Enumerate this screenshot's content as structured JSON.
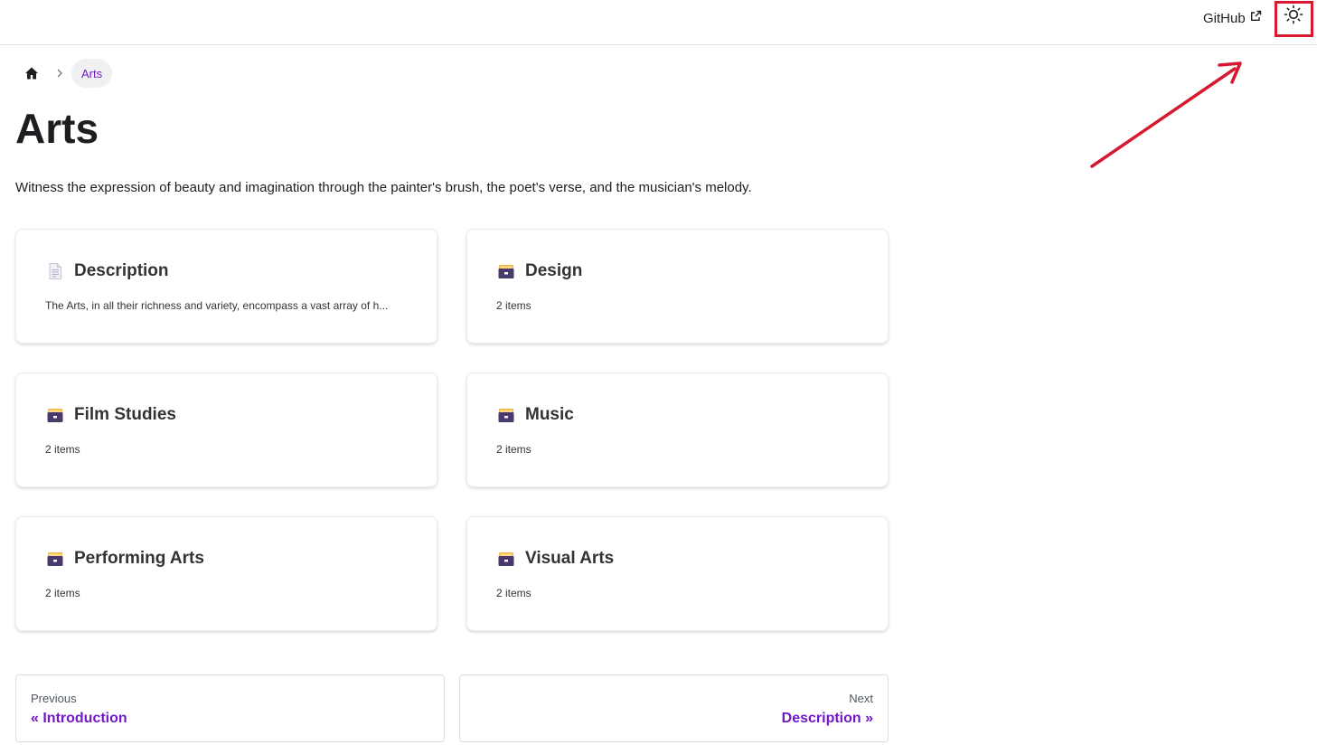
{
  "navbar": {
    "github_label": "GitHub"
  },
  "breadcrumb": {
    "current": "Arts"
  },
  "page": {
    "title": "Arts",
    "description": "Witness the expression of beauty and imagination through the painter's brush, the poet's verse, and the musician's melody."
  },
  "cards": [
    {
      "title": "Description",
      "subtitle": "The Arts, in all their richness and variety, encompass a vast array of h...",
      "icon": "document-icon"
    },
    {
      "title": "Design",
      "subtitle": "2 items",
      "icon": "folder-box-icon"
    },
    {
      "title": "Film Studies",
      "subtitle": "2 items",
      "icon": "folder-box-icon"
    },
    {
      "title": "Music",
      "subtitle": "2 items",
      "icon": "folder-box-icon"
    },
    {
      "title": "Performing Arts",
      "subtitle": "2 items",
      "icon": "folder-box-icon"
    },
    {
      "title": "Visual Arts",
      "subtitle": "2 items",
      "icon": "folder-box-icon"
    }
  ],
  "pagination": {
    "prev_sub": "Previous",
    "prev_label": "« Introduction",
    "next_sub": "Next",
    "next_label": "Description »"
  },
  "colors": {
    "accent": "#7118c7",
    "annotation": "#d7192f"
  }
}
